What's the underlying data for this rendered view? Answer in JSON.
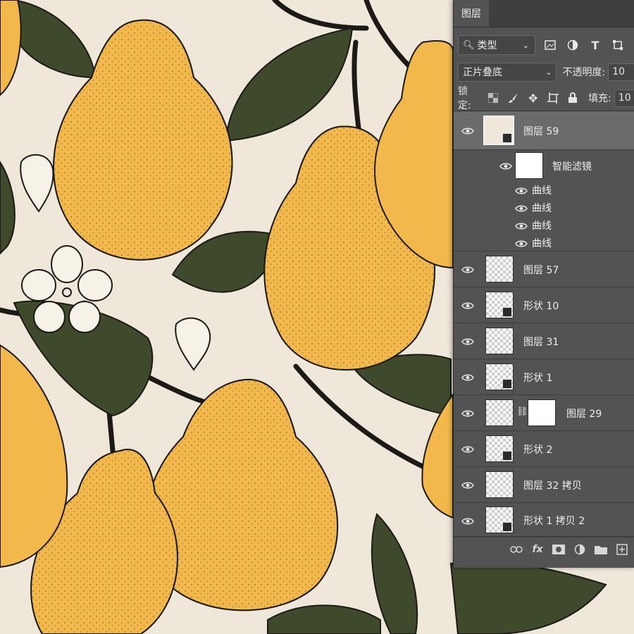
{
  "panel": {
    "tab_label": "图层",
    "filter": {
      "label": "类型",
      "icons": [
        "image-filter-icon",
        "adjustment-filter-icon",
        "type-filter-icon",
        "shape-filter-icon"
      ]
    },
    "blend_mode": "正片叠底",
    "opacity_label": "不透明度:",
    "opacity_value": "10",
    "lock_label": "锁定:",
    "lock_icons": [
      "lock-transparent-icon",
      "lock-paint-icon",
      "lock-move-icon",
      "lock-artboard-icon",
      "lock-all-icon"
    ],
    "fill_label": "填充:",
    "fill_value": "10"
  },
  "layers": [
    {
      "name": "图层 59",
      "selected": true,
      "thumb": "beige",
      "badge": true
    },
    {
      "name": "智能滤镜",
      "thumb": "white",
      "sub": true
    },
    {
      "name": "曲线",
      "effect": true
    },
    {
      "name": "曲线",
      "effect": true
    },
    {
      "name": "曲线",
      "effect": true
    },
    {
      "name": "曲线",
      "effect": true
    },
    {
      "name": "图层 57",
      "thumb": "transparent"
    },
    {
      "name": "形状 10",
      "thumb": "transparent",
      "badge": true
    },
    {
      "name": "图层 31",
      "thumb": "transparent"
    },
    {
      "name": "形状 1",
      "thumb": "transparent",
      "badge": true
    },
    {
      "name": "图层 29",
      "thumb": "transparent",
      "mask": true
    },
    {
      "name": "形状 2",
      "thumb": "transparent",
      "badge": true
    },
    {
      "name": "图层 32 拷贝",
      "thumb": "transparent"
    },
    {
      "name": "形状 1 拷贝 2",
      "thumb": "transparent",
      "badge": true
    }
  ],
  "bottom_icons": [
    "link-layers-icon",
    "fx-icon",
    "add-mask-icon",
    "new-adjustment-icon",
    "new-group-icon",
    "new-layer-icon"
  ],
  "bottom_fx_label": "fx",
  "colors": {
    "pear": "#f2b84c",
    "leaf": "#3f4a2c",
    "paper": "#efe7da",
    "ink": "#1b1a16",
    "panel": "#535353"
  }
}
